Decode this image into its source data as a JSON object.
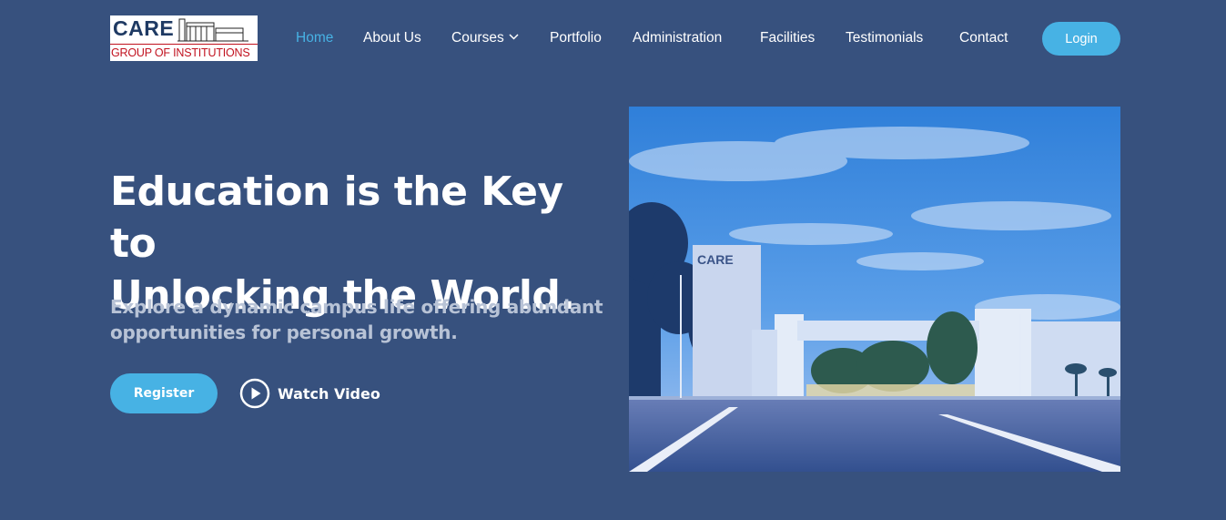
{
  "logo": {
    "brand": "CARE",
    "subtitle": "GROUP OF INSTITUTIONS"
  },
  "nav": {
    "items": [
      {
        "label": "Home",
        "active": true
      },
      {
        "label": "About Us"
      },
      {
        "label": "Courses",
        "has_dropdown": true
      },
      {
        "label": "Portfolio"
      },
      {
        "label": "Administration"
      },
      {
        "label": "Facilities"
      },
      {
        "label": "Testimonials"
      },
      {
        "label": "Contact"
      }
    ],
    "login_label": "Login"
  },
  "hero": {
    "headline_line1": "Education is the Key to",
    "headline_line2": "Unlocking the World.",
    "subtext_line1": "Explore a dynamic campus life offering abundant",
    "subtext_line2": "opportunities for personal growth.",
    "register_label": "Register",
    "watch_label": "Watch Video",
    "image_sign_text": "CARE"
  },
  "colors": {
    "background": "#37517e",
    "accent": "#47b2e4",
    "logo_red": "#c1121f",
    "logo_navy": "#1f3a63"
  }
}
